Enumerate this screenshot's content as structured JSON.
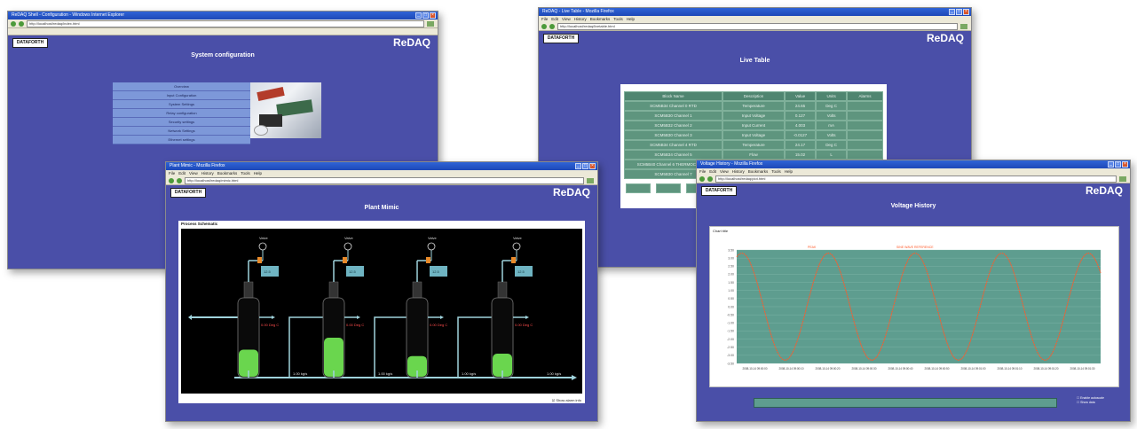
{
  "brand": "ReDAQ",
  "logo_text": "DATAFORTH",
  "colors": {
    "app_bg": "#4a4fa8",
    "table_cell": "#5e957e",
    "plot_bg": "#5e9d8f",
    "sine": "#ff5a2a",
    "tank_fill": "#6ad64e"
  },
  "win_config": {
    "title": "ReDAQ Shell - Configuration - Windows Internet Explorer",
    "url": "http://localhost/redaq/index.html",
    "page_title": "System configuration",
    "menu": [
      "Overview",
      "Input Configuration",
      "System Settings",
      "Relay configuration",
      "Security settings",
      "Network Settings",
      "Ethernet settings"
    ]
  },
  "win_live": {
    "title": "ReDAQ - Live Table - Mozilla Firefox",
    "menu_items": [
      "File",
      "Edit",
      "View",
      "History",
      "Bookmarks",
      "Tools",
      "Help"
    ],
    "url": "http://localhost/redaq/livetable.html",
    "page_title": "Live Table",
    "headers": [
      "Block Name",
      "Description",
      "Value",
      "Units",
      "Alarms"
    ],
    "rows": [
      [
        "SCM5B34 Channel 0 RTD",
        "Temperature",
        "24.65",
        "Deg C",
        ""
      ],
      [
        "SCM5B30 Channel 1",
        "Input Voltage",
        "0.127",
        "Volts",
        ""
      ],
      [
        "SCM5B32 Channel 2",
        "Input Current",
        "4.003",
        "mA",
        ""
      ],
      [
        "SCM5B30 Channel 3",
        "Input Voltage",
        "-0.0127",
        "Volts",
        ""
      ],
      [
        "SCM5B34 Channel 4 RTD",
        "Temperature",
        "24.17",
        "Deg C",
        ""
      ],
      [
        "SCM5B34 Channel 5",
        "Flow",
        "15.02",
        "L",
        ""
      ],
      [
        "SCM5B40 Channel 6 THERMOCOUPLE",
        "",
        "",
        "",
        ""
      ],
      [
        "SCM5B30 Channel 7",
        "",
        "",
        "",
        ""
      ]
    ]
  },
  "win_plant": {
    "title": "Plant Mimic - Mozilla Firefox",
    "menu_items": [
      "File",
      "Edit",
      "View",
      "History",
      "Bookmarks",
      "Tools",
      "Help"
    ],
    "url": "http://localhost/redaq/mimic.html",
    "page_title": "Plant Mimic",
    "panel_label": "Process Schematic",
    "footer_note": "Show alarm info",
    "valve_label": "Valve",
    "box_label": "12.5",
    "tank_text": "0.00 Deg C",
    "tanks": [
      {
        "fill": 0.35
      },
      {
        "fill": 0.5
      },
      {
        "fill": 0.27
      },
      {
        "fill": 0.3
      }
    ],
    "pipe_labels": [
      "1.00 kg/s",
      "1.00 kg/s",
      "1.00 kg/s",
      "1.00 kg/s"
    ]
  },
  "win_voltage": {
    "title": "Voltage History - Mozilla Firefox",
    "menu_items": [
      "File",
      "Edit",
      "View",
      "History",
      "Bookmarks",
      "Tools",
      "Help"
    ],
    "url": "http://localhost/redaq/plot.html",
    "page_title": "Voltage History",
    "panel_label": "Chart title",
    "legend": [
      "Enable autoscale",
      "Show data"
    ],
    "annotation_1": "PEAK",
    "annotation_2": "SINE WAVE REFERENCE",
    "chart_data": {
      "type": "line",
      "y_ticks": [
        "3.50",
        "3.00",
        "2.50",
        "2.00",
        "1.50",
        "1.00",
        "0.50",
        "0.00",
        "-0.50",
        "-1.00",
        "-1.50",
        "-2.00",
        "-2.50",
        "-3.00",
        "-3.50"
      ],
      "x_ticks": [
        "2008-10-14 09:00:00",
        "2008-10-14 09:00:10",
        "2008-10-14 09:00:20",
        "2008-10-14 09:00:30",
        "2008-10-14 09:00:40",
        "2008-10-14 09:00:50",
        "2008-10-14 09:01:00",
        "2008-10-14 09:01:10",
        "2008-10-14 09:01:20",
        "2008-10-14 09:01:30"
      ],
      "ylim": [
        -3.5,
        3.5
      ],
      "cycles": 4.2,
      "amplitude": 3.3
    }
  }
}
